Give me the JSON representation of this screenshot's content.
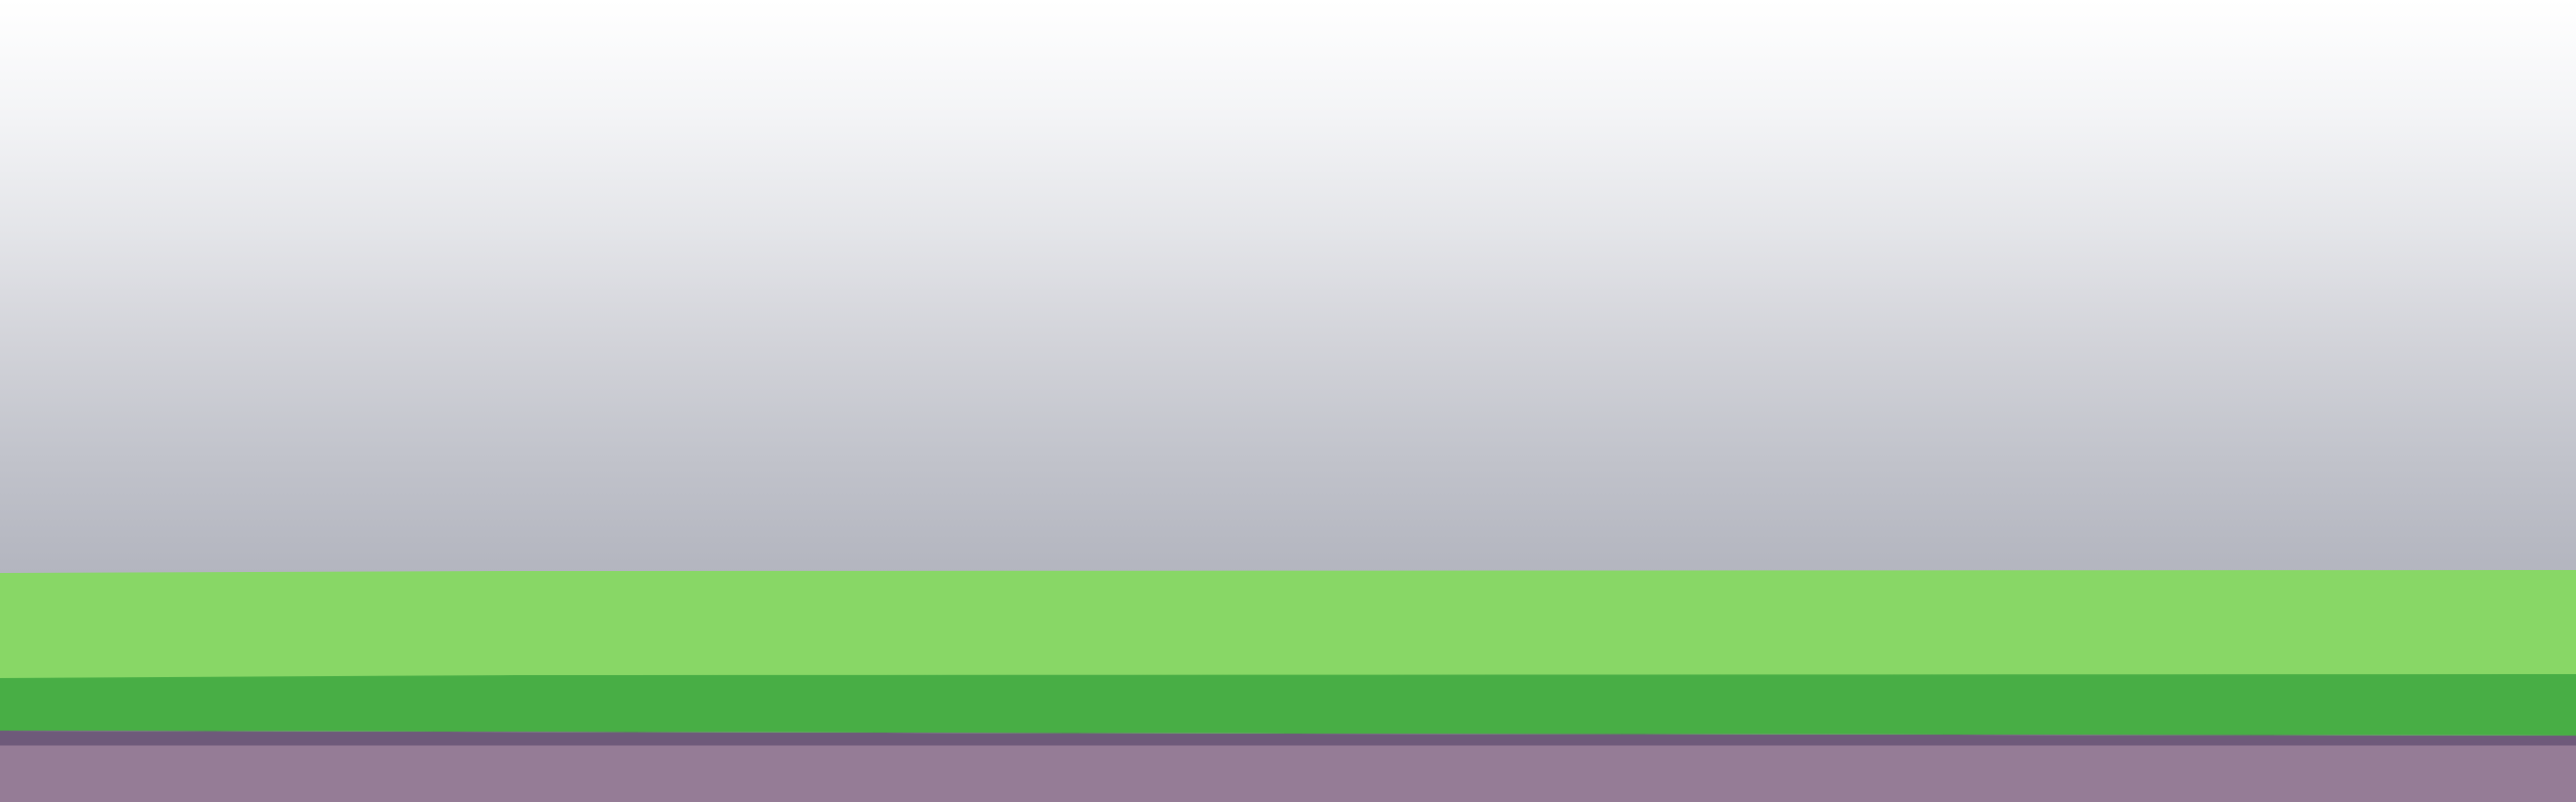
{
  "scene": {
    "colors": {
      "sky_top": "#ffffff",
      "sky_bottom": "#b3b5bf",
      "grass_light": "#88d766",
      "grass_dark": "#48ae45",
      "soil_edge": "#6e5a7a",
      "soil": "#957c96"
    }
  }
}
